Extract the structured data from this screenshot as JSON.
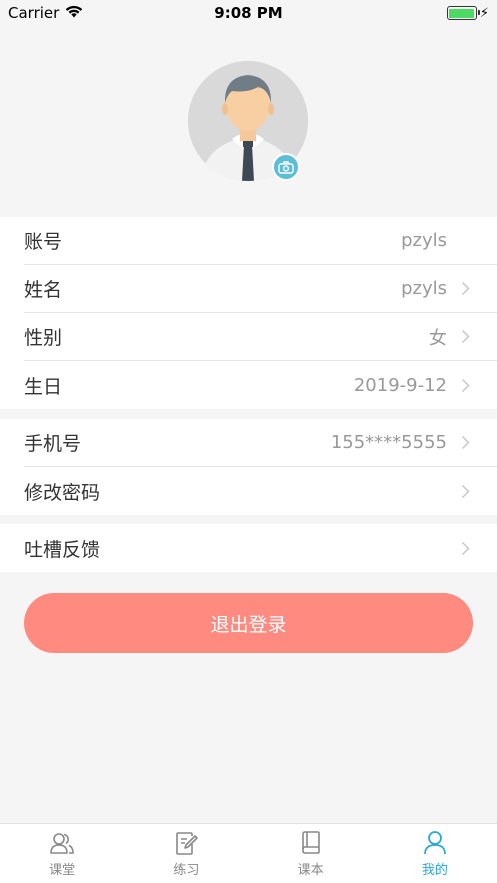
{
  "status_bar": {
    "carrier": "Carrier",
    "time": "9:08 PM"
  },
  "profile": {
    "avatar_icon": "person-avatar",
    "camera_icon": "camera-icon"
  },
  "account_group": [
    {
      "label": "账号",
      "value": "pzyls",
      "has_arrow": false
    },
    {
      "label": "姓名",
      "value": "pzyls",
      "has_arrow": true
    },
    {
      "label": "性别",
      "value": "女",
      "has_arrow": true
    },
    {
      "label": "生日",
      "value": "2019-9-12",
      "has_arrow": true
    }
  ],
  "security_group": [
    {
      "label": "手机号",
      "value": "155****5555",
      "has_arrow": true
    },
    {
      "label": "修改密码",
      "value": "",
      "has_arrow": true
    }
  ],
  "feedback_group": [
    {
      "label": "吐槽反馈",
      "value": "",
      "has_arrow": true
    }
  ],
  "logout_label": "退出登录",
  "tabbar": [
    {
      "label": "课堂",
      "icon": "classroom-icon",
      "active": false
    },
    {
      "label": "练习",
      "icon": "practice-icon",
      "active": false
    },
    {
      "label": "课本",
      "icon": "textbook-icon",
      "active": false
    },
    {
      "label": "我的",
      "icon": "profile-icon",
      "active": true
    }
  ],
  "colors": {
    "accent": "#2aa8d8",
    "logout_bg": "#ff8a80",
    "camera_bg": "#5bbdd6"
  }
}
